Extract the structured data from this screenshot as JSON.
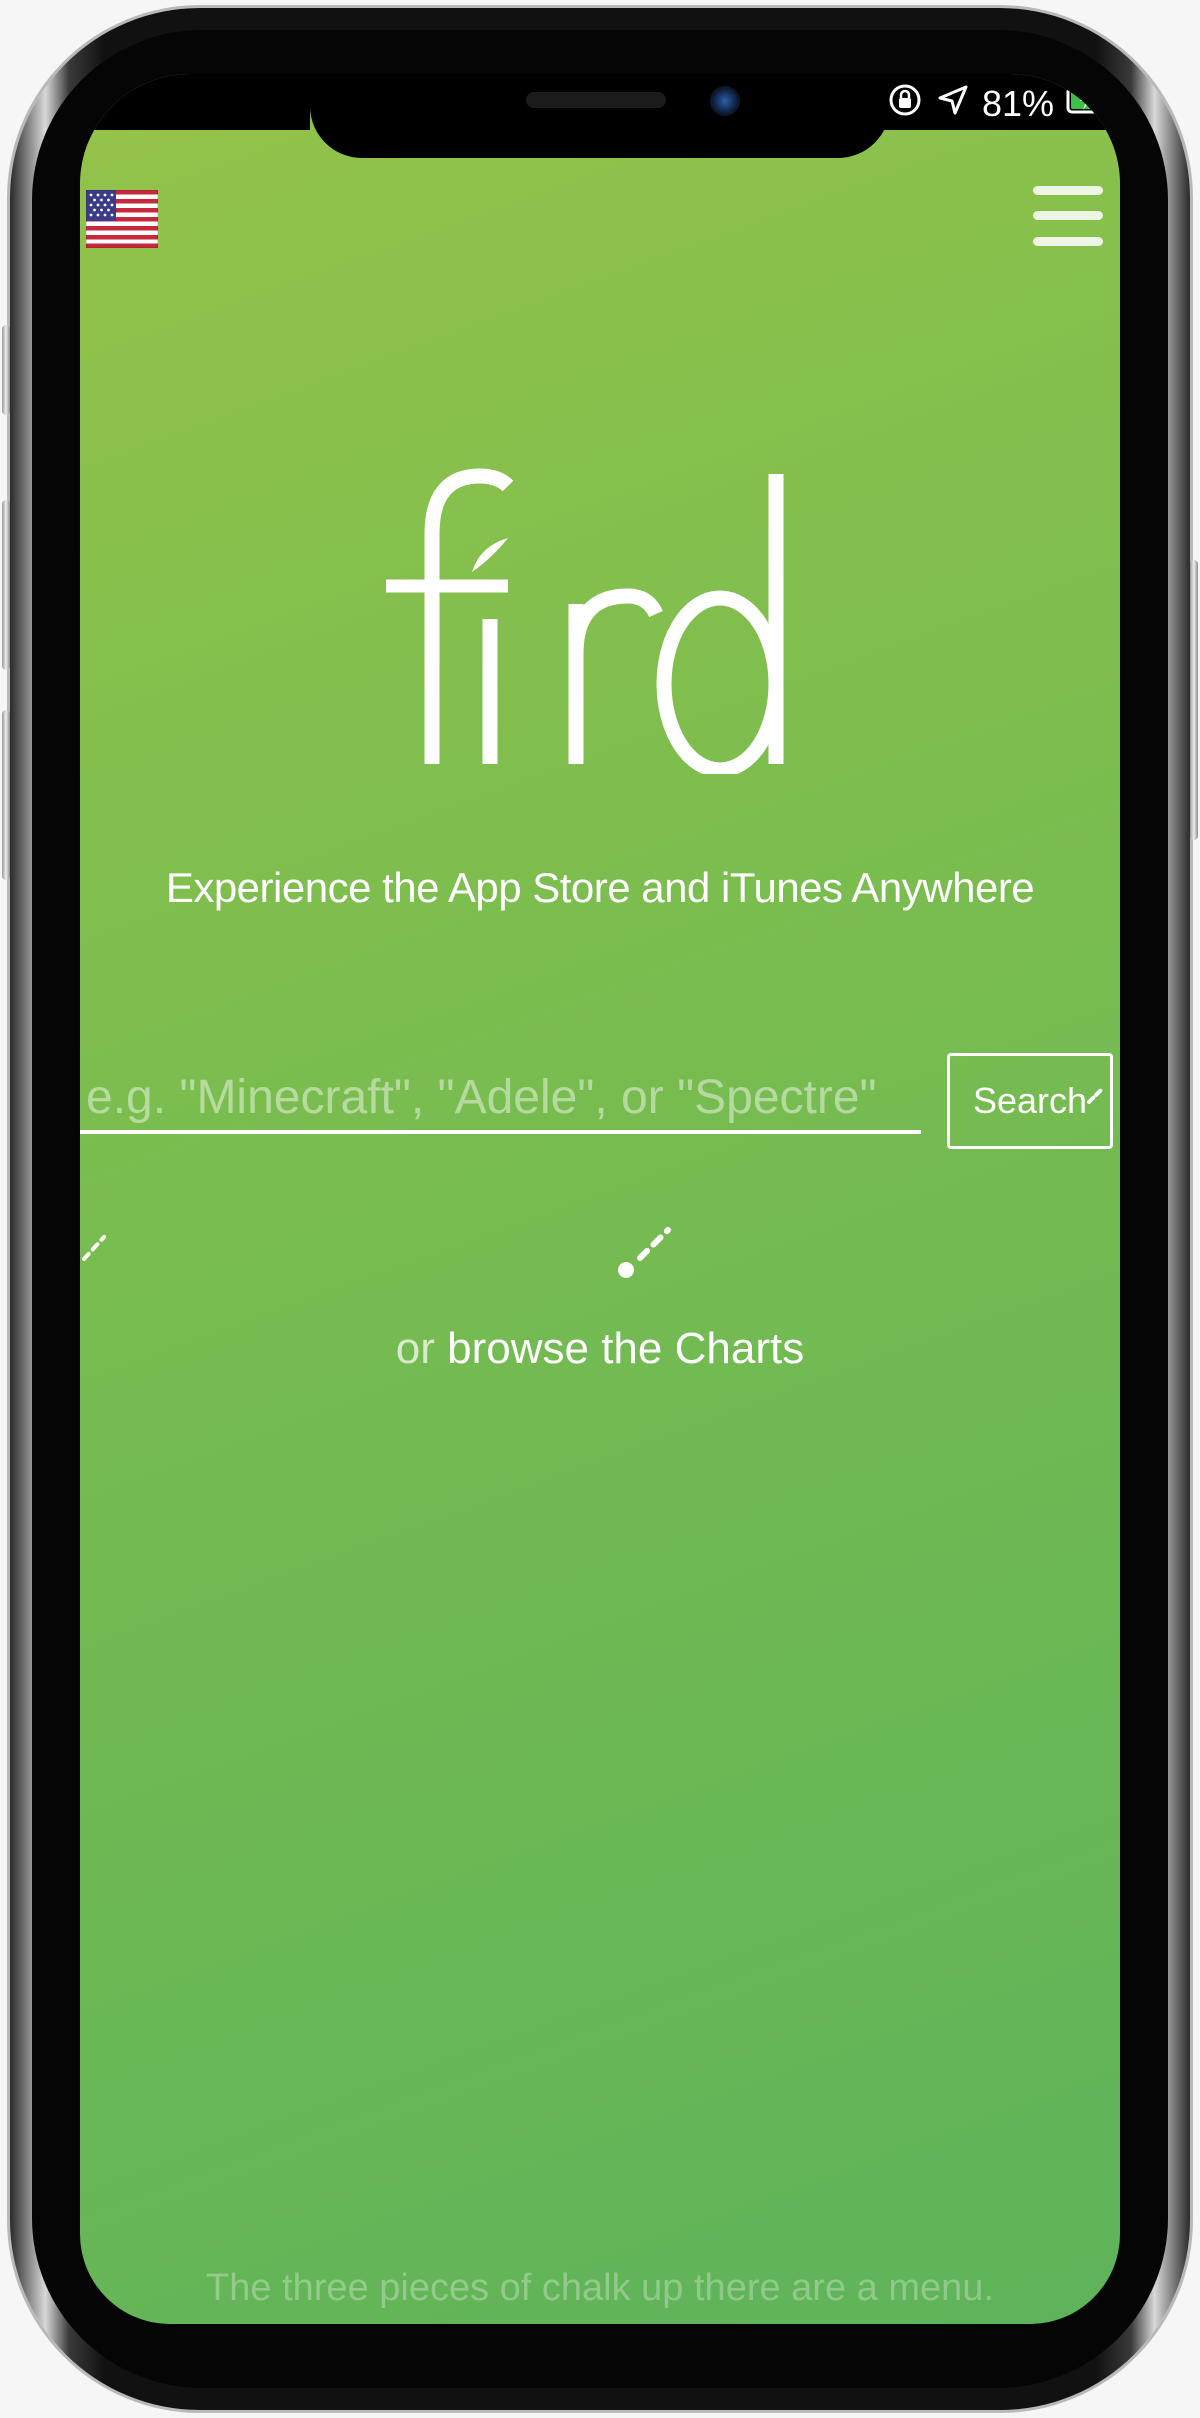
{
  "status_bar": {
    "battery_percent": "81%",
    "icons": [
      "rotation-lock-icon",
      "location-arrow-icon",
      "battery-charging-icon"
    ]
  },
  "header": {
    "flag_icon": "us-flag-icon",
    "menu_icon": "hamburger-menu-icon"
  },
  "logo": {
    "text": "find"
  },
  "tagline": "Experience the App Store and iTunes Anywhere",
  "search": {
    "placeholder": "e.g. \"Minecraft\", \"Adele\", or \"Spectre\"",
    "value": "",
    "button_label": "Search"
  },
  "browse": {
    "prefix": "or",
    "link_label": "browse the Charts"
  },
  "footer_hint": "The three pieces of chalk up there are a menu.",
  "colors": {
    "gradient_start": "#94c34a",
    "gradient_end": "#5eb35a",
    "text": "#ffffff"
  }
}
